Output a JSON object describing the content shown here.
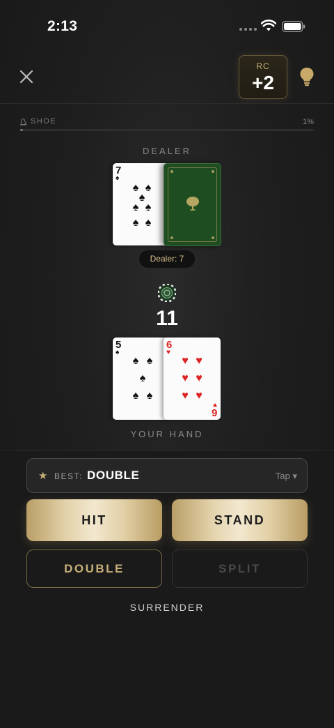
{
  "status_bar": {
    "time": "2:13"
  },
  "header": {
    "close_icon": "close-icon",
    "rc_label": "RC",
    "rc_value": "+2",
    "hint_icon": "lightbulb-icon"
  },
  "shoe": {
    "label": "SHOE",
    "percent_text": "1%",
    "progress": 0.01
  },
  "dealer": {
    "label": "DEALER",
    "card": {
      "rank": "7",
      "suit": "spades"
    },
    "hole_card": "face-down",
    "total_text": "Dealer: 7"
  },
  "player": {
    "total": "11",
    "label": "YOUR HAND",
    "cards": [
      {
        "rank": "5",
        "suit": "spades"
      },
      {
        "rank": "6",
        "suit": "hearts"
      }
    ]
  },
  "recommendation": {
    "label": "BEST:",
    "value": "DOUBLE",
    "tap_text": "Tap ▾"
  },
  "actions": {
    "hit": "HIT",
    "stand": "STAND",
    "double": "DOUBLE",
    "split": "SPLIT",
    "surrender": "SURRENDER"
  },
  "colors": {
    "gold": "#c9b07a",
    "felt_green": "#1f4d22",
    "background": "#1a1a1a"
  }
}
